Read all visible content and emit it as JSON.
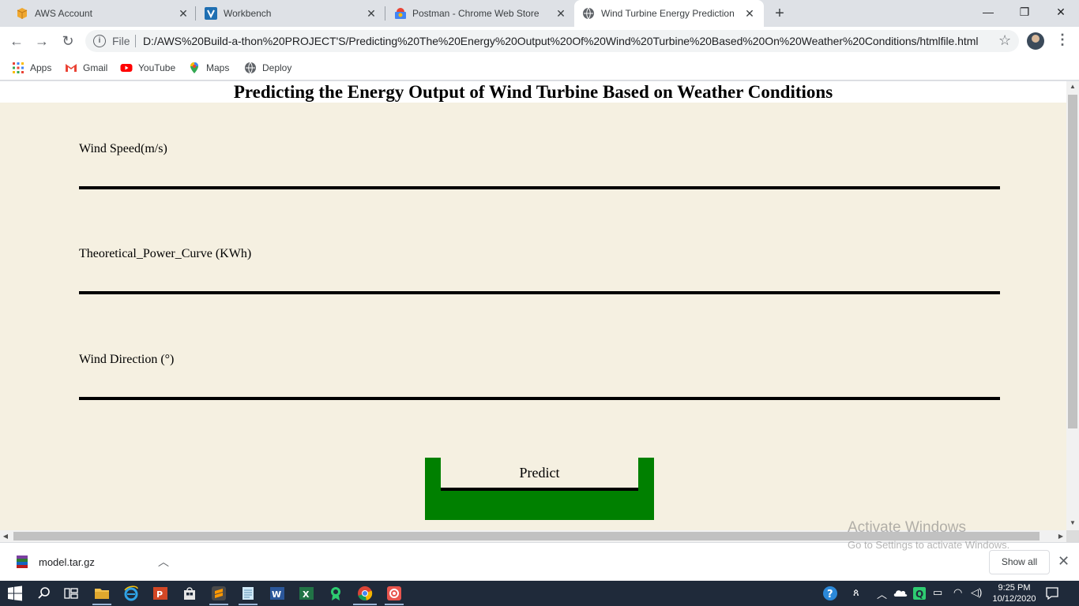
{
  "tabs": [
    {
      "title": "AWS Account",
      "favicon": "aws-cube-icon"
    },
    {
      "title": "Workbench",
      "favicon": "v-logo-icon"
    },
    {
      "title": "Postman - Chrome Web Store",
      "favicon": "webstore-icon"
    },
    {
      "title": "Wind Turbine Energy Prediction",
      "favicon": "globe-icon",
      "active": true
    }
  ],
  "address_bar": {
    "scheme_label": "File",
    "url": "D:/AWS%20Build-a-thon%20PROJECT'S/Predicting%20The%20Energy%20Output%20Of%20Wind%20Turbine%20Based%20On%20Weather%20Conditions/htmlfile.html"
  },
  "bookmarks": [
    {
      "label": "Apps",
      "icon": "apps-grid-icon"
    },
    {
      "label": "Gmail",
      "icon": "gmail-icon"
    },
    {
      "label": "YouTube",
      "icon": "youtube-icon"
    },
    {
      "label": "Maps",
      "icon": "maps-pin-icon"
    },
    {
      "label": "Deploy",
      "icon": "globe-icon"
    }
  ],
  "page": {
    "heading": "Predicting the Energy Output of Wind Turbine Based on Weather Conditions",
    "fields": [
      {
        "label": "Wind Speed(m/s)",
        "value": ""
      },
      {
        "label": "Theoretical_Power_Curve (KWh)",
        "value": ""
      },
      {
        "label": "Wind Direction (°)",
        "value": ""
      }
    ],
    "predict_label": "Predict",
    "colors": {
      "background": "#f5f0e1",
      "button": "#008000"
    }
  },
  "watermark": {
    "line1": "Activate Windows",
    "line2": "Go to Settings to activate Windows."
  },
  "download_shelf": {
    "filename": "model.tar.gz",
    "show_all": "Show all"
  },
  "taskbar": {
    "time": "9:25 PM",
    "date": "10/12/2020"
  }
}
